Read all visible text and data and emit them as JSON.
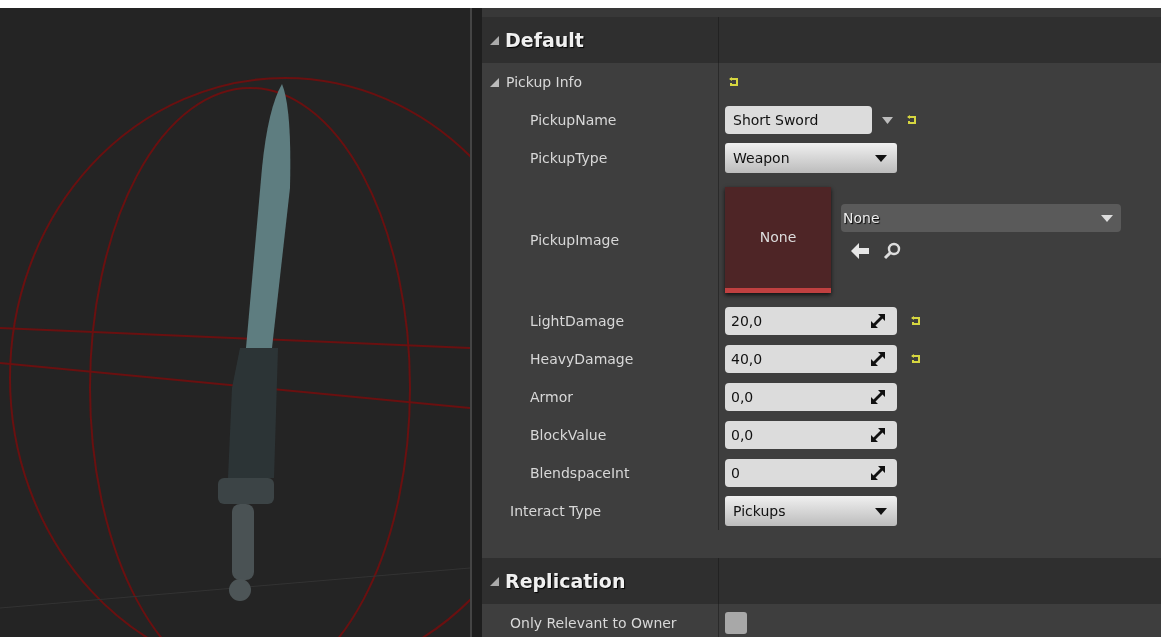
{
  "sections": [
    {
      "title": "Default",
      "expanded": true,
      "rows": [
        {
          "kind": "group",
          "label": "Pickup Info",
          "expanded": true,
          "resettable": true,
          "children": [
            {
              "kind": "text",
              "label": "PickupName",
              "value": "Short Sword",
              "resettable": true
            },
            {
              "kind": "enum",
              "label": "PickupType",
              "value": "Weapon",
              "resettable": false
            },
            {
              "kind": "asset",
              "label": "PickupImage",
              "thumbnail": "None",
              "value": "None",
              "resettable": false
            },
            {
              "kind": "number",
              "label": "LightDamage",
              "value": "20,0",
              "resettable": true
            },
            {
              "kind": "number",
              "label": "HeavyDamage",
              "value": "40,0",
              "resettable": true
            },
            {
              "kind": "number",
              "label": "Armor",
              "value": "0,0",
              "resettable": false
            },
            {
              "kind": "number",
              "label": "BlockValue",
              "value": "0,0",
              "resettable": false
            },
            {
              "kind": "number",
              "label": "BlendspaceInt",
              "value": "0",
              "resettable": false
            }
          ]
        },
        {
          "kind": "enum",
          "label": "Interact Type",
          "value": "Pickups",
          "resettable": false
        }
      ]
    },
    {
      "title": "Replication",
      "expanded": true,
      "rows": [
        {
          "kind": "checkbox",
          "label": "Only Relevant to Owner",
          "checked": false,
          "resettable": false
        }
      ]
    }
  ]
}
